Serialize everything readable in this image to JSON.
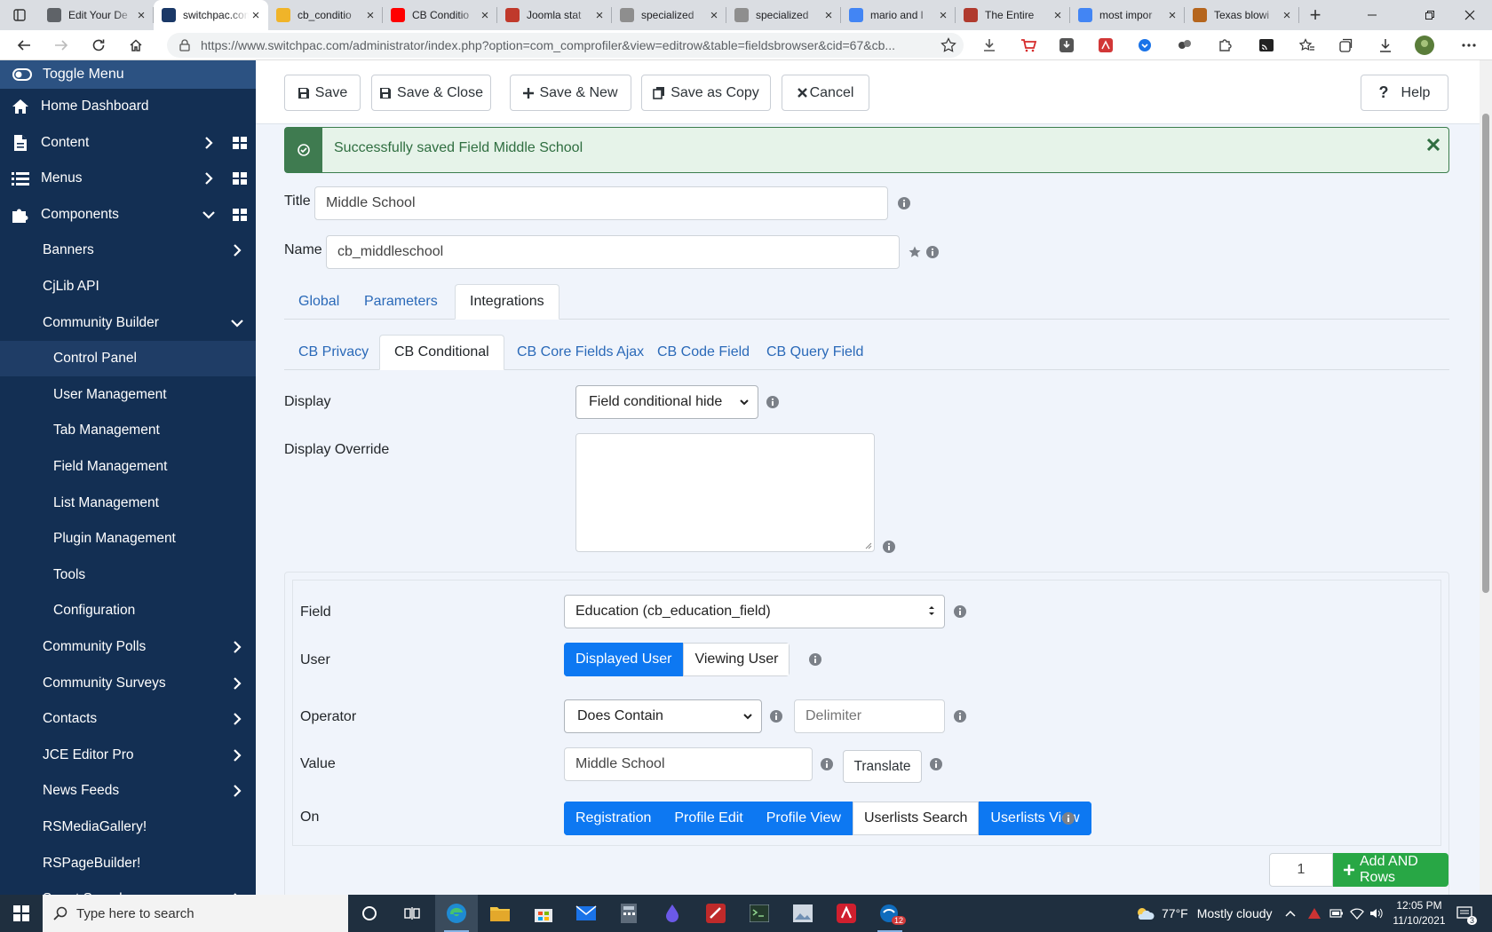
{
  "browser": {
    "tabs": [
      {
        "title": "Edit Your De",
        "favicon_color": "#5f6368"
      },
      {
        "title": "switchpac.com",
        "favicon_color": "#1a3867",
        "active": true
      },
      {
        "title": "cb_conditio",
        "favicon_color": "#f0b429"
      },
      {
        "title": "CB Conditio",
        "favicon_color": "#ff0000"
      },
      {
        "title": "Joomla stat",
        "favicon_color": "#c0392b"
      },
      {
        "title": "specialized",
        "favicon_color": "#8e8e8e"
      },
      {
        "title": "specialized",
        "favicon_color": "#8e8e8e"
      },
      {
        "title": "mario and l",
        "favicon_color": "#4285f4"
      },
      {
        "title": "The Entire",
        "favicon_color": "#b03a2e"
      },
      {
        "title": "most impor",
        "favicon_color": "#4285f4"
      },
      {
        "title": "Texas blowi",
        "favicon_color": "#b5651d"
      }
    ],
    "url": "https://www.switchpac.com/administrator/index.php?option=com_comprofiler&view=editrow&table=fieldsbrowser&cid=67&cb..."
  },
  "sidebar": {
    "toggle_label": "Toggle Menu",
    "items": [
      {
        "label": "Home Dashboard",
        "icon": "home-icon",
        "level": 1
      },
      {
        "label": "Content",
        "icon": "file-icon",
        "level": 1,
        "chevron": "right",
        "grid": true
      },
      {
        "label": "Menus",
        "icon": "list-icon",
        "level": 1,
        "chevron": "right",
        "grid": true
      },
      {
        "label": "Components",
        "icon": "puzzle-icon",
        "level": 1,
        "chevron": "down",
        "grid": true
      },
      {
        "label": "Banners",
        "level": 2,
        "chevron": "right"
      },
      {
        "label": "CjLib API",
        "level": 2
      },
      {
        "label": "Community Builder",
        "level": 2,
        "chevron": "down"
      },
      {
        "label": "Control Panel",
        "level": 3,
        "active": true
      },
      {
        "label": "User Management",
        "level": 3
      },
      {
        "label": "Tab Management",
        "level": 3
      },
      {
        "label": "Field Management",
        "level": 3
      },
      {
        "label": "List Management",
        "level": 3
      },
      {
        "label": "Plugin Management",
        "level": 3
      },
      {
        "label": "Tools",
        "level": 3
      },
      {
        "label": "Configuration",
        "level": 3
      },
      {
        "label": "Community Polls",
        "level": 2,
        "chevron": "right"
      },
      {
        "label": "Community Surveys",
        "level": 2,
        "chevron": "right"
      },
      {
        "label": "Contacts",
        "level": 2,
        "chevron": "right"
      },
      {
        "label": "JCE Editor Pro",
        "level": 2,
        "chevron": "right"
      },
      {
        "label": "News Feeds",
        "level": 2,
        "chevron": "right"
      },
      {
        "label": "RSMediaGallery!",
        "level": 2
      },
      {
        "label": "RSPageBuilder!",
        "level": 2
      },
      {
        "label": "Smart Search",
        "level": 2,
        "chevron": "right"
      }
    ]
  },
  "toolbar": {
    "save": "Save",
    "save_close": "Save & Close",
    "save_new": "Save & New",
    "save_copy": "Save as Copy",
    "cancel": "Cancel",
    "help": "Help"
  },
  "alert": {
    "message": "Successfully saved Field Middle School"
  },
  "form": {
    "title_label": "Title",
    "title_value": "Middle School",
    "name_label": "Name",
    "name_value": "cb_middleschool",
    "tabs": [
      "Global",
      "Parameters",
      "Integrations"
    ],
    "active_tab": "Integrations",
    "subtabs": [
      "CB Privacy",
      "CB Conditional",
      "CB Core Fields Ajax",
      "CB Code Field",
      "CB Query Field"
    ],
    "active_subtab": "CB Conditional",
    "display_label": "Display",
    "display_value": "Field conditional hide",
    "override_label": "Display Override"
  },
  "condition": {
    "field_label": "Field",
    "field_value": "Education (cb_education_field)",
    "user_label": "User",
    "user_options": [
      {
        "label": "Displayed User",
        "selected": true
      },
      {
        "label": "Viewing User",
        "selected": false
      }
    ],
    "operator_label": "Operator",
    "operator_value": "Does Contain",
    "delimiter_placeholder": "Delimiter",
    "value_label": "Value",
    "value_value": "Middle School",
    "translate_label": "Translate",
    "on_label": "On",
    "on_options": [
      {
        "label": "Registration",
        "selected": true
      },
      {
        "label": "Profile Edit",
        "selected": true
      },
      {
        "label": "Profile View",
        "selected": true
      },
      {
        "label": "Userlists Search",
        "selected": false
      },
      {
        "label": "Userlists View",
        "selected": true
      }
    ],
    "rows_count": "1",
    "add_rows_label": "Add AND Rows"
  },
  "taskbar": {
    "search_placeholder": "Type here to search",
    "weather_temp": "77°F",
    "weather_desc": "Mostly cloudy",
    "time": "12:05 PM",
    "date": "11/10/2021",
    "notif_count": "3",
    "mail_badge": "12"
  },
  "colors": {
    "primary": "#0d78f2",
    "success": "#28a745",
    "sidebar": "#132f53",
    "link": "#2a69b8"
  }
}
